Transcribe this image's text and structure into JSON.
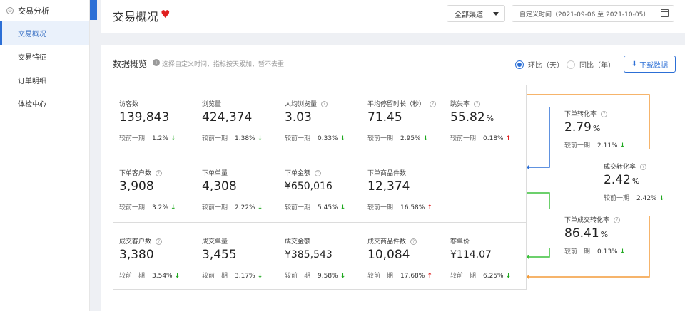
{
  "sidebar": {
    "section": "交易分析",
    "items": [
      {
        "label": "交易概况"
      },
      {
        "label": "交易特征"
      },
      {
        "label": "订单明细"
      },
      {
        "label": "体检中心"
      }
    ]
  },
  "header": {
    "title": "交易概况",
    "channel_select": "全部渠道",
    "date_range": "自定义时间（2021-09-06 至 2021-10-05）"
  },
  "overview": {
    "title": "数据概览",
    "hint": "选择自定义时间，指标按天累加，暂不去重",
    "radio_hb": "环比（天）",
    "radio_tb": "同比（年）",
    "download": "下载数据",
    "compare_label": "较前一期"
  },
  "metrics": [
    {
      "label": "访客数",
      "value": "139,843",
      "pct": "1.2%",
      "dir": "down"
    },
    {
      "label": "浏览量",
      "value": "424,374",
      "pct": "1.38%",
      "dir": "down"
    },
    {
      "label": "人均浏览量",
      "value": "3.03",
      "pct": "0.33%",
      "dir": "down"
    },
    {
      "label": "平均停留时长（秒）",
      "value": "71.45",
      "pct": "2.95%",
      "dir": "down"
    },
    {
      "label": "跳失率",
      "value": "55.82",
      "unit": "%",
      "pct": "0.18%",
      "dir": "up"
    },
    {
      "label": "下单客户数",
      "value": "3,908",
      "pct": "3.2%",
      "dir": "down"
    },
    {
      "label": "下单单量",
      "value": "4,308",
      "pct": "2.22%",
      "dir": "down"
    },
    {
      "label": "下单金额",
      "value": "¥650,016",
      "pct": "5.45%",
      "dir": "down"
    },
    {
      "label": "下单商品件数",
      "value": "12,374",
      "pct": "16.58%",
      "dir": "up"
    },
    {
      "label": "成交客户数",
      "value": "3,380",
      "pct": "3.54%",
      "dir": "down"
    },
    {
      "label": "成交单量",
      "value": "3,455",
      "pct": "3.17%",
      "dir": "down"
    },
    {
      "label": "成交金额",
      "value": "¥385,543",
      "pct": "9.58%",
      "dir": "down"
    },
    {
      "label": "成交商品件数",
      "value": "10,084",
      "pct": "17.68%",
      "dir": "up"
    },
    {
      "label": "客单价",
      "value": "¥114.07",
      "pct": "6.25%",
      "dir": "down"
    }
  ],
  "funnel": [
    {
      "label": "下单转化率",
      "value": "2.79",
      "unit": "%",
      "pct": "2.11%",
      "dir": "down"
    },
    {
      "label": "成交转化率",
      "value": "2.42",
      "unit": "%",
      "pct": "2.42%",
      "dir": "down"
    },
    {
      "label": "下单成交转化率",
      "value": "86.41",
      "unit": "%",
      "pct": "0.13%",
      "dir": "down"
    }
  ],
  "colors": {
    "accent": "#2c6fd6",
    "up": "#e02020",
    "down": "#1fa81f",
    "orange": "#f39c3a",
    "green": "#3cc13c"
  }
}
